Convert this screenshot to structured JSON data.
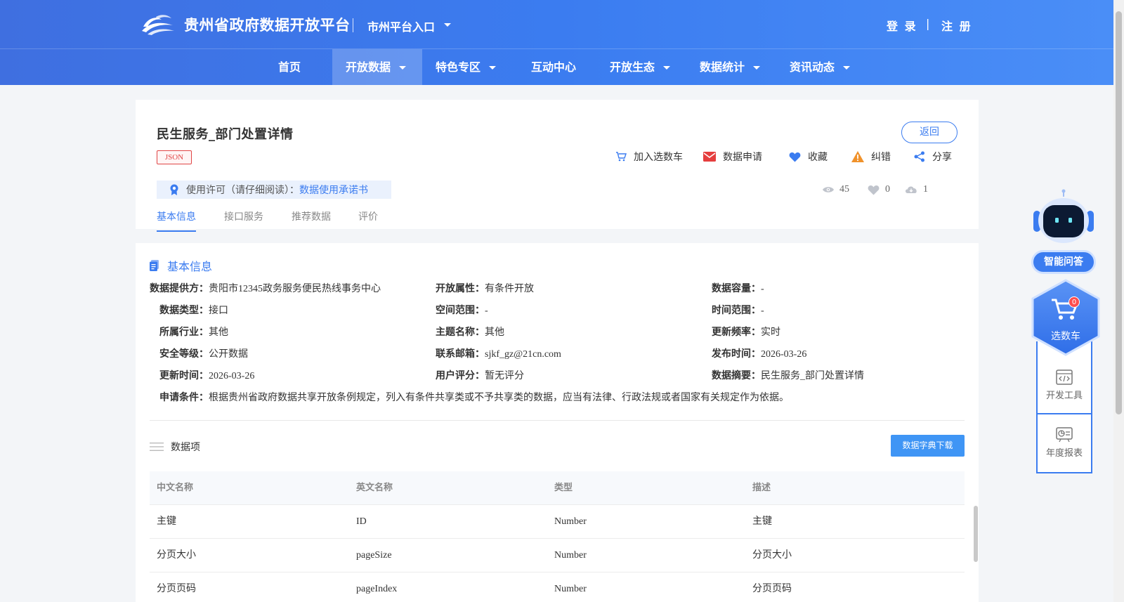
{
  "header": {
    "site_title": "贵州省政府数据开放平台",
    "city_entry": "市州平台入口",
    "login": "登 录",
    "separator": "|",
    "register": "注 册"
  },
  "nav": [
    {
      "label": "首页",
      "has_dropdown": false
    },
    {
      "label": "开放数据",
      "has_dropdown": true,
      "active": true
    },
    {
      "label": "特色专区",
      "has_dropdown": true
    },
    {
      "label": "互动中心",
      "has_dropdown": false
    },
    {
      "label": "开放生态",
      "has_dropdown": true
    },
    {
      "label": "数据统计",
      "has_dropdown": true
    },
    {
      "label": "资讯动态",
      "has_dropdown": true
    }
  ],
  "dataset": {
    "title": "民生服务_部门处置详情",
    "format_tag": "JSON",
    "back": "返回",
    "actions": {
      "add_cart": "加入选数车",
      "apply": "数据申请",
      "favorite": "收藏",
      "report": "纠错",
      "share": "分享"
    },
    "license_label": "使用许可（请仔细阅读）：",
    "license_link": "数据使用承诺书",
    "stats": {
      "views": "45",
      "likes": "0",
      "downloads": "1"
    },
    "tabs": [
      "基本信息",
      "接口服务",
      "推荐数据",
      "评价"
    ]
  },
  "basic_info": {
    "title": "基本信息",
    "fields": {
      "provider": {
        "label": "数据提供方：",
        "value": "贵阳市12345政务服务便民热线事务中心"
      },
      "open_attr": {
        "label": "开放属性：",
        "value": "有条件开放"
      },
      "capacity": {
        "label": "数据容量：",
        "value": "-"
      },
      "data_type": {
        "label": "数据类型：",
        "value": "接口"
      },
      "space_range": {
        "label": "空间范围：",
        "value": "-"
      },
      "time_range": {
        "label": "时间范围：",
        "value": "-"
      },
      "industry": {
        "label": "所属行业：",
        "value": "其他"
      },
      "topic": {
        "label": "主题名称：",
        "value": "其他"
      },
      "frequency": {
        "label": "更新频率：",
        "value": "实时"
      },
      "security": {
        "label": "安全等级：",
        "value": "公开数据"
      },
      "email": {
        "label": "联系邮箱：",
        "value": "sjkf_gz@21cn.com"
      },
      "publish_time": {
        "label": "发布时间：",
        "value": "2026-03-26"
      },
      "update_time": {
        "label": "更新时间：",
        "value": "2026-03-26"
      },
      "rating": {
        "label": "用户评分：",
        "value": "暂无评分"
      },
      "summary": {
        "label": "数据摘要：",
        "value": "民生服务_部门处置详情"
      },
      "condition": {
        "label": "申请条件：",
        "value": "根据贵州省政府数据共享开放条例规定，列入有条件共享类或不予共享类的数据，应当有法律、行政法规或者国家有关规定作为依据。"
      }
    }
  },
  "data_items": {
    "title": "数据项",
    "download_button": "数据字典下载",
    "columns": [
      "中文名称",
      "英文名称",
      "类型",
      "描述"
    ],
    "rows": [
      [
        "主键",
        "ID",
        "Number",
        "主键"
      ],
      [
        "分页大小",
        "pageSize",
        "Number",
        "分页大小"
      ],
      [
        "分页页码",
        "pageIndex",
        "Number",
        "分页页码"
      ]
    ]
  },
  "side": {
    "ai_qa": "智能问答",
    "cart": "选数车",
    "cart_count": "0",
    "dev_tools": "开发工具",
    "annual_report": "年度报表"
  }
}
